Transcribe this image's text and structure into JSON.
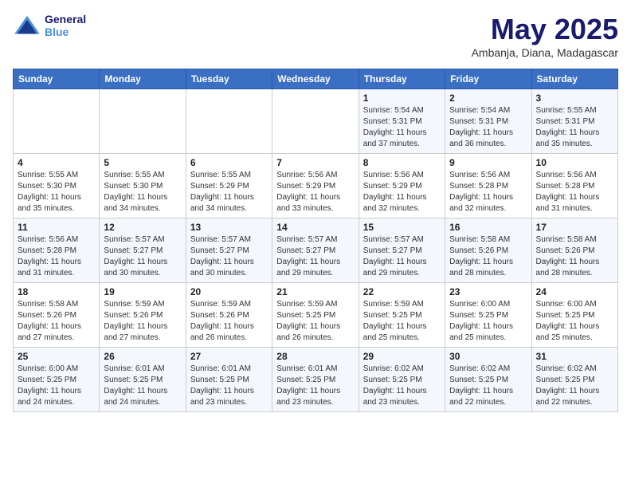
{
  "header": {
    "logo_line1": "General",
    "logo_line2": "Blue",
    "month_title": "May 2025",
    "location": "Ambanja, Diana, Madagascar"
  },
  "weekdays": [
    "Sunday",
    "Monday",
    "Tuesday",
    "Wednesday",
    "Thursday",
    "Friday",
    "Saturday"
  ],
  "weeks": [
    [
      {
        "day": "",
        "info": ""
      },
      {
        "day": "",
        "info": ""
      },
      {
        "day": "",
        "info": ""
      },
      {
        "day": "",
        "info": ""
      },
      {
        "day": "1",
        "info": "Sunrise: 5:54 AM\nSunset: 5:31 PM\nDaylight: 11 hours\nand 37 minutes."
      },
      {
        "day": "2",
        "info": "Sunrise: 5:54 AM\nSunset: 5:31 PM\nDaylight: 11 hours\nand 36 minutes."
      },
      {
        "day": "3",
        "info": "Sunrise: 5:55 AM\nSunset: 5:31 PM\nDaylight: 11 hours\nand 35 minutes."
      }
    ],
    [
      {
        "day": "4",
        "info": "Sunrise: 5:55 AM\nSunset: 5:30 PM\nDaylight: 11 hours\nand 35 minutes."
      },
      {
        "day": "5",
        "info": "Sunrise: 5:55 AM\nSunset: 5:30 PM\nDaylight: 11 hours\nand 34 minutes."
      },
      {
        "day": "6",
        "info": "Sunrise: 5:55 AM\nSunset: 5:29 PM\nDaylight: 11 hours\nand 34 minutes."
      },
      {
        "day": "7",
        "info": "Sunrise: 5:56 AM\nSunset: 5:29 PM\nDaylight: 11 hours\nand 33 minutes."
      },
      {
        "day": "8",
        "info": "Sunrise: 5:56 AM\nSunset: 5:29 PM\nDaylight: 11 hours\nand 32 minutes."
      },
      {
        "day": "9",
        "info": "Sunrise: 5:56 AM\nSunset: 5:28 PM\nDaylight: 11 hours\nand 32 minutes."
      },
      {
        "day": "10",
        "info": "Sunrise: 5:56 AM\nSunset: 5:28 PM\nDaylight: 11 hours\nand 31 minutes."
      }
    ],
    [
      {
        "day": "11",
        "info": "Sunrise: 5:56 AM\nSunset: 5:28 PM\nDaylight: 11 hours\nand 31 minutes."
      },
      {
        "day": "12",
        "info": "Sunrise: 5:57 AM\nSunset: 5:27 PM\nDaylight: 11 hours\nand 30 minutes."
      },
      {
        "day": "13",
        "info": "Sunrise: 5:57 AM\nSunset: 5:27 PM\nDaylight: 11 hours\nand 30 minutes."
      },
      {
        "day": "14",
        "info": "Sunrise: 5:57 AM\nSunset: 5:27 PM\nDaylight: 11 hours\nand 29 minutes."
      },
      {
        "day": "15",
        "info": "Sunrise: 5:57 AM\nSunset: 5:27 PM\nDaylight: 11 hours\nand 29 minutes."
      },
      {
        "day": "16",
        "info": "Sunrise: 5:58 AM\nSunset: 5:26 PM\nDaylight: 11 hours\nand 28 minutes."
      },
      {
        "day": "17",
        "info": "Sunrise: 5:58 AM\nSunset: 5:26 PM\nDaylight: 11 hours\nand 28 minutes."
      }
    ],
    [
      {
        "day": "18",
        "info": "Sunrise: 5:58 AM\nSunset: 5:26 PM\nDaylight: 11 hours\nand 27 minutes."
      },
      {
        "day": "19",
        "info": "Sunrise: 5:59 AM\nSunset: 5:26 PM\nDaylight: 11 hours\nand 27 minutes."
      },
      {
        "day": "20",
        "info": "Sunrise: 5:59 AM\nSunset: 5:26 PM\nDaylight: 11 hours\nand 26 minutes."
      },
      {
        "day": "21",
        "info": "Sunrise: 5:59 AM\nSunset: 5:25 PM\nDaylight: 11 hours\nand 26 minutes."
      },
      {
        "day": "22",
        "info": "Sunrise: 5:59 AM\nSunset: 5:25 PM\nDaylight: 11 hours\nand 25 minutes."
      },
      {
        "day": "23",
        "info": "Sunrise: 6:00 AM\nSunset: 5:25 PM\nDaylight: 11 hours\nand 25 minutes."
      },
      {
        "day": "24",
        "info": "Sunrise: 6:00 AM\nSunset: 5:25 PM\nDaylight: 11 hours\nand 25 minutes."
      }
    ],
    [
      {
        "day": "25",
        "info": "Sunrise: 6:00 AM\nSunset: 5:25 PM\nDaylight: 11 hours\nand 24 minutes."
      },
      {
        "day": "26",
        "info": "Sunrise: 6:01 AM\nSunset: 5:25 PM\nDaylight: 11 hours\nand 24 minutes."
      },
      {
        "day": "27",
        "info": "Sunrise: 6:01 AM\nSunset: 5:25 PM\nDaylight: 11 hours\nand 23 minutes."
      },
      {
        "day": "28",
        "info": "Sunrise: 6:01 AM\nSunset: 5:25 PM\nDaylight: 11 hours\nand 23 minutes."
      },
      {
        "day": "29",
        "info": "Sunrise: 6:02 AM\nSunset: 5:25 PM\nDaylight: 11 hours\nand 23 minutes."
      },
      {
        "day": "30",
        "info": "Sunrise: 6:02 AM\nSunset: 5:25 PM\nDaylight: 11 hours\nand 22 minutes."
      },
      {
        "day": "31",
        "info": "Sunrise: 6:02 AM\nSunset: 5:25 PM\nDaylight: 11 hours\nand 22 minutes."
      }
    ]
  ]
}
